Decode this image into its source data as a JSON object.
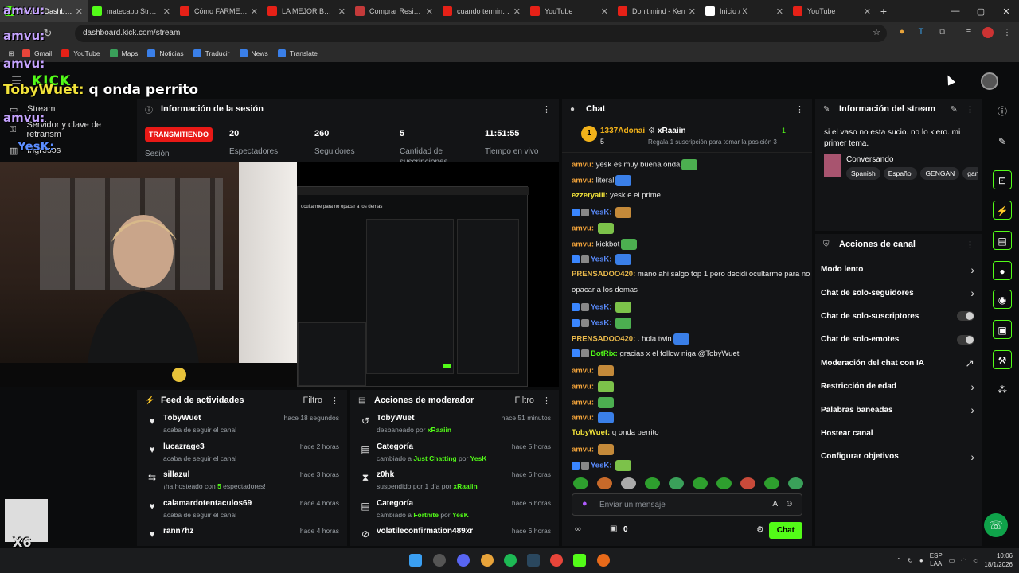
{
  "browser": {
    "tabs": [
      {
        "title": "Stream Dashboard",
        "color": "#53fc18"
      },
      {
        "title": "matecapp Stream",
        "color": "#53fc18"
      },
      {
        "title": "Cómo FARMEAR",
        "color": "#e62117"
      },
      {
        "title": "LA MEJOR Base C",
        "color": "#e62117"
      },
      {
        "title": "Comprar Residen",
        "color": "#c43a3a"
      },
      {
        "title": "cuando termine e",
        "color": "#e62117"
      },
      {
        "title": "YouTube",
        "color": "#e62117"
      },
      {
        "title": "Don't mind - Ken",
        "color": "#e62117"
      },
      {
        "title": "Inicio / X",
        "color": "#ffffff"
      },
      {
        "title": "YouTube",
        "color": "#e62117"
      }
    ],
    "url": "dashboard.kick.com/stream",
    "bookmarks": [
      "Gmail",
      "YouTube",
      "Maps",
      "Noticias",
      "Traducir",
      "News",
      "Translate"
    ]
  },
  "overlay": {
    "lines": [
      {
        "user": "amvu:",
        "text": ""
      },
      {
        "user": "amvu:",
        "text": ""
      },
      {
        "user": "amvu:",
        "text": ""
      },
      {
        "user": "TobyWuet:",
        "text": "q onda perrito"
      },
      {
        "user": "amvu:",
        "text": ""
      },
      {
        "user": "YesK:",
        "text": ""
      }
    ],
    "x6": "X6"
  },
  "kick": {
    "logo": "KICK"
  },
  "left_sidebar": {
    "items": [
      "Stream",
      "Servidor y clave de retransm",
      "Ingresos"
    ]
  },
  "session": {
    "title": "Información de la sesión",
    "live": "TRANSMITIENDO",
    "live_sub": "Sesión",
    "stats": [
      {
        "value": "20",
        "label": "Espectadores"
      },
      {
        "value": "260",
        "label": "Seguidores"
      },
      {
        "value": "5",
        "label": "Cantidad de suscripciones"
      },
      {
        "value": "11:51:55",
        "label": "Tiempo en vivo"
      }
    ],
    "screen_caption": "ocultarme para no opacar a los demas"
  },
  "feed": {
    "title": "Feed de actividades",
    "filter": "Filtro",
    "items": [
      {
        "name": "TobyWuet",
        "sub": "acaba de seguir el canal",
        "time": "hace 18 segundos",
        "icon": "heart-icon"
      },
      {
        "name": "lucazrage3",
        "sub": "acaba de seguir el canal",
        "time": "hace 2 horas",
        "icon": "heart-icon"
      },
      {
        "name": "sillazul",
        "sub_pre": "¡ha hosteado con ",
        "sub_hl": "5",
        "sub_post": " espectadores!",
        "time": "hace 3 horas",
        "icon": "host-icon"
      },
      {
        "name": "calamardotentaculos69",
        "sub": "acaba de seguir el canal",
        "time": "hace 4 horas",
        "icon": "heart-icon"
      },
      {
        "name": "rann7hz",
        "sub": "",
        "time": "hace 4 horas",
        "icon": "heart-icon"
      }
    ]
  },
  "mod_actions": {
    "title": "Acciones de moderador",
    "filter": "Filtro",
    "items": [
      {
        "name": "TobyWuet",
        "pre": "desbaneado por ",
        "hl": "xRaaiin",
        "mid": "",
        "hl2": "",
        "time": "hace 51 minutos",
        "icon": "unban-icon"
      },
      {
        "name": "Categoría",
        "pre": "cambiado a ",
        "hl": "Just Chatting",
        "mid": " por ",
        "hl2": "YesK",
        "time": "hace 5 horas",
        "icon": "category-icon"
      },
      {
        "name": "z0hk",
        "pre": "suspendido por 1 día por ",
        "hl": "xRaaiin",
        "mid": "",
        "hl2": "",
        "time": "hace 6 horas",
        "icon": "timeout-icon"
      },
      {
        "name": "Categoría",
        "pre": "cambiado a ",
        "hl": "Fortnite",
        "mid": " por ",
        "hl2": "YesK",
        "time": "hace 6 horas",
        "icon": "category-icon"
      },
      {
        "name": "volatileconfirmation489xr",
        "pre": "",
        "hl": "",
        "mid": "",
        "hl2": "",
        "time": "hace 6 horas",
        "icon": "ban-icon"
      }
    ]
  },
  "chat": {
    "title": "Chat",
    "top1": {
      "name": "1337Adonai",
      "count": "5",
      "rank": "1"
    },
    "top2": {
      "name": "xRaaiin",
      "sub": "Regala 1 suscripción para tomar la posición 3",
      "rank": "1"
    },
    "messages": [
      {
        "user": "amvu",
        "cls": "u-amvu",
        "text": "yesk es muy buena onda",
        "emote": true
      },
      {
        "user": "amvu",
        "cls": "u-amvu",
        "text": "literal",
        "emote": true
      },
      {
        "user": "ezzeryalll",
        "cls": "u-ezz",
        "text": "yesk e el prime",
        "emote": false
      },
      {
        "user": "YesK",
        "cls": "u-yesk",
        "text": "",
        "emote": true,
        "badges": true
      },
      {
        "user": "amvu",
        "cls": "u-amvu",
        "text": "",
        "emote": true
      },
      {
        "user": "amvu",
        "cls": "u-amvu",
        "text": "kickbot",
        "emote": true
      },
      {
        "user": "YesK",
        "cls": "u-yesk",
        "text": "",
        "emote": true,
        "badges": true
      },
      {
        "user": "PRENSADOO420",
        "cls": "u-pren",
        "text": "mano ahi salgo top 1 pero decidi ocultarme para no",
        "emote": false
      },
      {
        "user": "",
        "cls": "",
        "text": "opacar a los demas",
        "emote": false
      },
      {
        "user": "YesK",
        "cls": "u-yesk",
        "text": "",
        "emote": true,
        "badges": true
      },
      {
        "user": "YesK",
        "cls": "u-yesk",
        "text": "",
        "emote": true,
        "badges": true
      },
      {
        "user": "PRENSADOO420",
        "cls": "u-pren",
        "text": ". hola twin",
        "emote": true
      },
      {
        "user": "BotRix",
        "cls": "u-botrix",
        "text": "gracias x el follow niga @TobyWuet",
        "emote": false,
        "badges": true
      },
      {
        "user": "amvu",
        "cls": "u-amvu",
        "text": "",
        "emote": true
      },
      {
        "user": "amvu",
        "cls": "u-amvu",
        "text": "",
        "emote": true
      },
      {
        "user": "amvu",
        "cls": "u-amvu",
        "text": "",
        "emote": true
      },
      {
        "user": "amvu",
        "cls": "u-amvu",
        "text": "",
        "emote": true
      },
      {
        "user": "TobyWuet",
        "cls": "u-toby",
        "text": "q onda perrito",
        "emote": false
      },
      {
        "user": "amvu",
        "cls": "u-amvu",
        "text": "",
        "emote": true
      },
      {
        "user": "YesK",
        "cls": "u-yesk",
        "text": "",
        "emote": true,
        "badges": true
      }
    ],
    "input_placeholder": "Enviar un mensaje",
    "points": "0",
    "send": "Chat"
  },
  "stream_info": {
    "title": "Información del stream",
    "stream_title": "si el vaso no esta sucio. no lo kiero. mi primer tema.",
    "category": "Conversando",
    "tags": [
      "Spanish",
      "Español",
      "GENGAN",
      "gan"
    ]
  },
  "channel_actions": {
    "title": "Acciones de canal",
    "items": [
      {
        "label": "Modo lento",
        "kind": "chevron"
      },
      {
        "label": "Chat de solo-seguidores",
        "kind": "chevron"
      },
      {
        "label": "Chat de solo-suscriptores",
        "kind": "toggle"
      },
      {
        "label": "Chat de solo-emotes",
        "kind": "toggle"
      },
      {
        "label": "Moderación del chat con IA",
        "kind": "external"
      },
      {
        "label": "Restricción de edad",
        "kind": "chevron"
      },
      {
        "label": "Palabras baneadas",
        "kind": "chevron"
      },
      {
        "label": "Hostear canal",
        "kind": "none"
      },
      {
        "label": "Configurar objetivos",
        "kind": "chevron"
      }
    ]
  },
  "taskbar": {
    "lang": "ESP",
    "lang2": "LAA",
    "time": "10:06",
    "date": "18/1/2026"
  },
  "colors": {
    "kick_green": "#53fc18",
    "live_red": "#e91916",
    "panel_bg": "#131416"
  }
}
